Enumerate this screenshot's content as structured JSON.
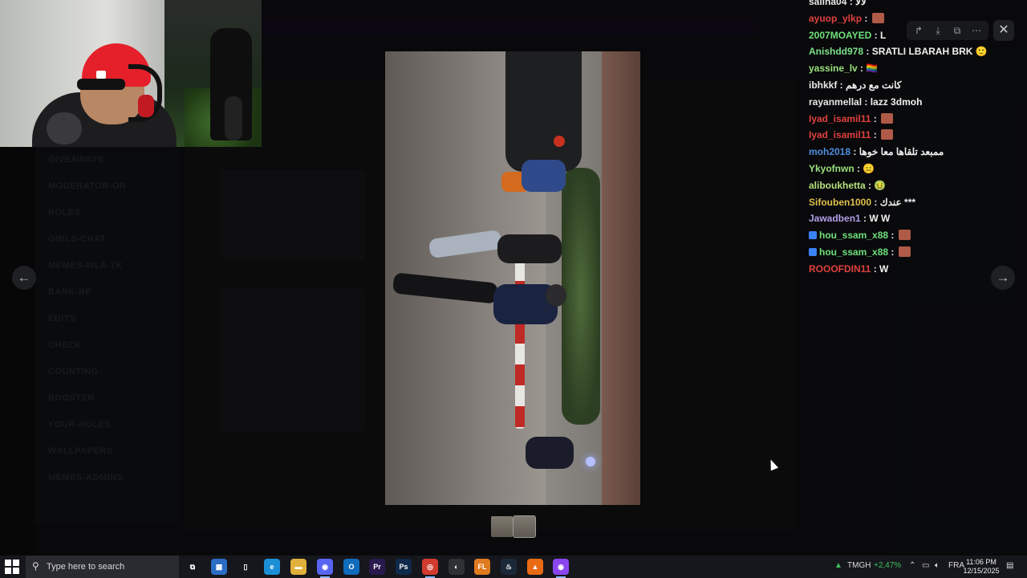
{
  "background_channels": [
    "GIVEAWAYS",
    "MODERATOR-ON",
    "ROLES",
    "GIRLS-CHAT",
    "MEMES-WLA-7K",
    "BANK-RP",
    "EDITS",
    "CHECK",
    "COUNTING",
    "BOOSTER",
    "YOUR-ROLES",
    "WALLPAPERS",
    "MEMES-ADMINS"
  ],
  "viewer": {
    "prev_icon": "arrow-left-icon",
    "next_icon": "arrow-right-icon",
    "toolbar": [
      {
        "name": "forward-icon",
        "glyph": "↱"
      },
      {
        "name": "download-icon",
        "glyph": "⤓"
      },
      {
        "name": "open-external-icon",
        "glyph": "⧉"
      },
      {
        "name": "more-icon",
        "glyph": "⋯"
      }
    ],
    "close_glyph": "✕",
    "prev_glyph": "←",
    "next_glyph": "→"
  },
  "chat": [
    {
      "user": "saliha04",
      "color": "#e8e8e8",
      "msg": "لالا"
    },
    {
      "user": "ayuop_ylkp",
      "color": "#e0413e",
      "msg": "",
      "emote": "#b05a48"
    },
    {
      "user": "2007MOAYED",
      "color": "#6fe07a",
      "msg": "L"
    },
    {
      "user": "Anishdd978",
      "color": "#7de08a",
      "msg": "SRATLI LBARAH BRK 🙂"
    },
    {
      "user": "yassine_lv",
      "color": "#9be07d",
      "msg": "🏳️‍🌈"
    },
    {
      "user": "ibhkkf",
      "color": "#e8e8e8",
      "msg": "كانت مع درهم"
    },
    {
      "user": "rayanmellal",
      "color": "#e8e8e8",
      "msg": "lazz 3dmoh"
    },
    {
      "user": "Iyad_isamil11",
      "color": "#e0413e",
      "msg": "",
      "emote": "#b05a48"
    },
    {
      "user": "Iyad_isamil11",
      "color": "#e0413e",
      "msg": "",
      "emote": "#b05a48"
    },
    {
      "user": "moh2018",
      "color": "#4e8fe0",
      "msg": "ممبعد تلقاها معا خوها"
    },
    {
      "user": "Ykyofnwn",
      "color": "#9ae07d",
      "msg": "😑"
    },
    {
      "user": "aliboukhetta",
      "color": "#b6e07d",
      "msg": "🤢"
    },
    {
      "user": "Sifouben1000",
      "color": "#e0c04e",
      "msg": "عندك ***"
    },
    {
      "user": "Jawadben1",
      "color": "#b09ee8",
      "msg": "W  W"
    },
    {
      "user": "hou_ssam_x88",
      "color": "#6fe07a",
      "msg": "",
      "emote": "#b05a48",
      "badge": true
    },
    {
      "user": "hou_ssam_x88",
      "color": "#6fe07a",
      "msg": "",
      "emote": "#b05a48",
      "badge": true
    },
    {
      "user": "ROOOFDIN11",
      "color": "#e0413e",
      "msg": "W"
    }
  ],
  "taskbar": {
    "search_placeholder": "Type here to search",
    "apps": [
      {
        "name": "task-view-icon",
        "label": "⧉",
        "bg": "transparent"
      },
      {
        "name": "store-icon",
        "label": "▦",
        "bg": "#2b6cc4"
      },
      {
        "name": "file-icon",
        "label": "▯",
        "bg": "transparent"
      },
      {
        "name": "edge-icon",
        "label": "e",
        "bg": "#1b8fd6"
      },
      {
        "name": "folder-icon",
        "label": "▬",
        "bg": "#e0b03a"
      },
      {
        "name": "discord-icon",
        "label": "◉",
        "bg": "#5865f2",
        "active": true
      },
      {
        "name": "outlook-icon",
        "label": "O",
        "bg": "#0f6cbd"
      },
      {
        "name": "premiere-icon",
        "label": "Pr",
        "bg": "#2a1a4e"
      },
      {
        "name": "photoshop-icon",
        "label": "Ps",
        "bg": "#0f2a4a"
      },
      {
        "name": "chrome-icon",
        "label": "◎",
        "bg": "#d13b2f",
        "active": true
      },
      {
        "name": "obs-icon",
        "label": "◐",
        "bg": "#303133"
      },
      {
        "name": "fl-studio-icon",
        "label": "FL",
        "bg": "#e07a1e"
      },
      {
        "name": "steam-icon",
        "label": "♨",
        "bg": "#1b2838"
      },
      {
        "name": "vlc-icon",
        "label": "▲",
        "bg": "#e86a14"
      },
      {
        "name": "twitch-icon",
        "label": "◉",
        "bg": "#8a45f0",
        "active": true
      }
    ],
    "stock_name": "TMGH",
    "stock_change": "+2,47%",
    "language": "FRA",
    "time": "11:06 PM",
    "date": "12/15/2025"
  }
}
